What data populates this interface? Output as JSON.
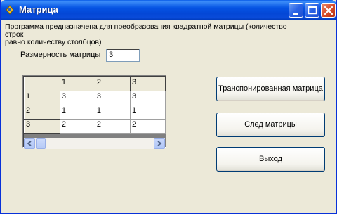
{
  "window": {
    "title": "Матрица"
  },
  "form": {
    "description_line1": "Программа предназначена для  преобразования квадратной матрицы (количество строк",
    "description_line2": "равно количеству столбцов)",
    "size_label": "Размерность матрицы",
    "size_value": "3"
  },
  "grid": {
    "column_headers": [
      "1",
      "2",
      "3"
    ],
    "rows": [
      {
        "header": "1",
        "cells": [
          "3",
          "3",
          "3"
        ]
      },
      {
        "header": "2",
        "cells": [
          "1",
          "1",
          "1"
        ]
      },
      {
        "header": "3",
        "cells": [
          "2",
          "2",
          "2"
        ]
      }
    ]
  },
  "buttons": {
    "transpose": "Транспонированная матрица",
    "trace": "След матрицы",
    "exit": "Выход"
  },
  "icons": {
    "app": "app-icon",
    "minimize": "minimize-icon",
    "maximize": "maximize-icon",
    "close": "close-icon",
    "scroll_left": "arrow-left-icon",
    "scroll_right": "arrow-right-icon"
  },
  "colors": {
    "titlebar": "#0553e3",
    "window_bg": "#ece9d8",
    "close_button": "#d94d2b"
  }
}
